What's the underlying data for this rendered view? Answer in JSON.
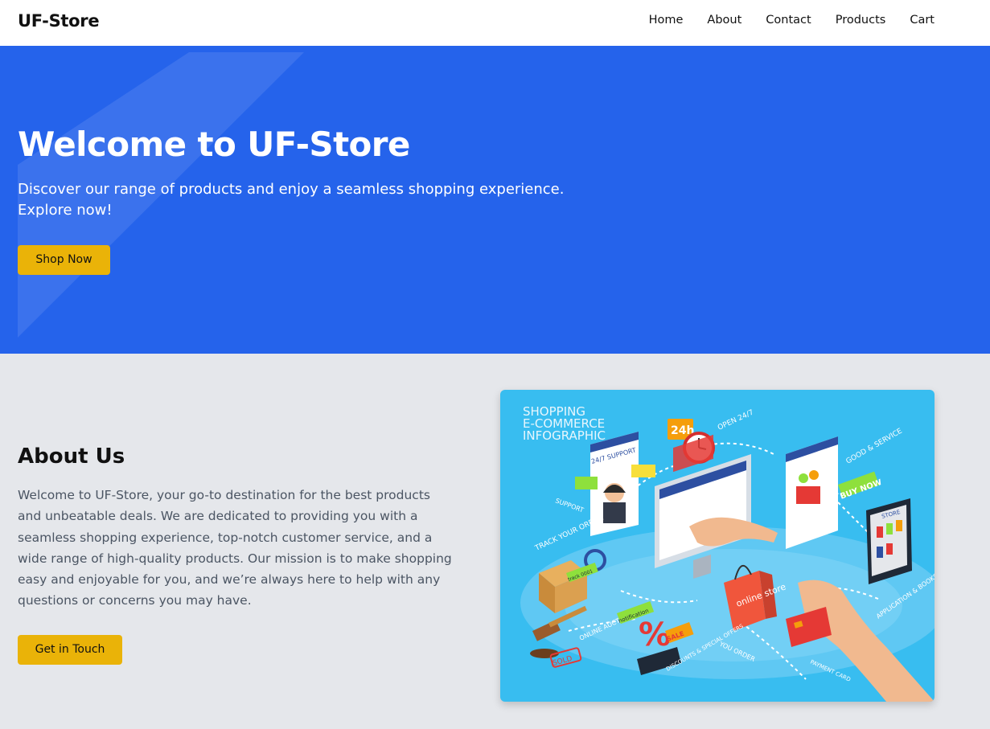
{
  "nav": {
    "logo": "UF-Store",
    "links": [
      "Home",
      "About",
      "Contact",
      "Products",
      "Cart"
    ]
  },
  "hero": {
    "title": "Welcome to UF-Store",
    "subtitle": "Discover our range of products and enjoy a seamless shopping experience. Explore now!",
    "button_label": "Shop Now"
  },
  "about": {
    "title": "About Us",
    "text": "Welcome to UF-Store, your go-to destination for the best products and unbeatable deals. We are dedicated to providing you with a seamless shopping experience, top-notch customer service, and a wide range of high-quality products. Our mission is to make shopping easy and enjoyable for you, and we’re always here to help with any questions or concerns you may have.",
    "button_label": "Get in Touch",
    "image": {
      "heading_lines": [
        "SHOPPING",
        "E-COMMERCE",
        "INFOGRAPHIC"
      ],
      "labels": {
        "support_247": "24/7 SUPPORT",
        "h24": "24h",
        "open_247": "OPEN 24/7",
        "good_service": "GOOD & SERVICE",
        "buy_now": "BUY NOW",
        "support": "SUPPORT",
        "track_order": "TRACK YOUR ORDER",
        "store": "STORE",
        "application": "APPLICATION & BOOKS STORE",
        "online_store": "online store",
        "online_auction": "ONLINE AUCTION",
        "notification": "notification",
        "sale": "SALE",
        "you_order": "YOU ORDER",
        "discounts": "DISCOUNTS & SPECIAL OFFERS",
        "payment_card": "PAYMENT CARD",
        "sold": "SOLD",
        "track_code": "track 0001"
      }
    }
  },
  "colors": {
    "hero_bg": "#2563eb",
    "accent": "#eab308",
    "page_bg": "#e5e7eb",
    "image_bg": "#38bdf0"
  }
}
